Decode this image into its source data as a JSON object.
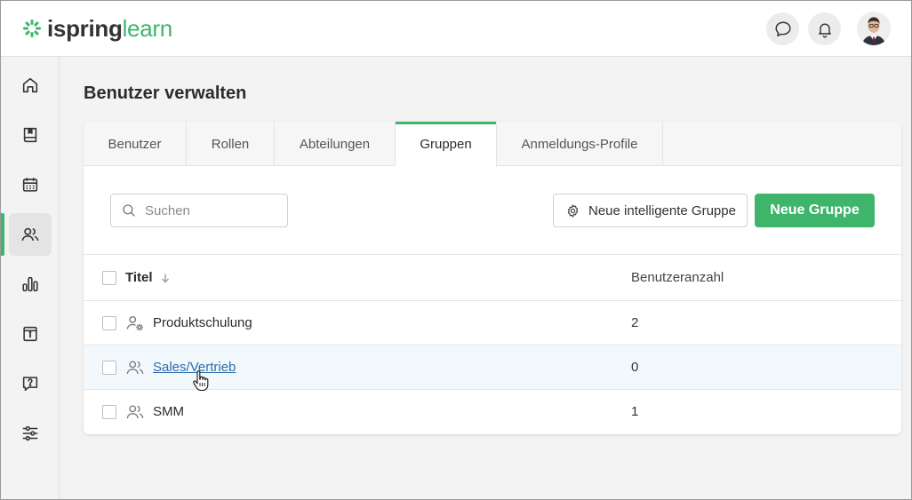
{
  "app": {
    "logo_part1": "ispring",
    "logo_part2": "learn",
    "brand_color": "#3fb56c"
  },
  "header": {
    "icons": [
      "chat-icon",
      "bell-icon"
    ]
  },
  "sidebar": {
    "items": [
      {
        "name": "home-icon"
      },
      {
        "name": "book-icon"
      },
      {
        "name": "calendar-icon"
      },
      {
        "name": "users-icon",
        "active": true
      },
      {
        "name": "reports-icon"
      },
      {
        "name": "info-icon"
      },
      {
        "name": "help-icon"
      },
      {
        "name": "settings-sliders-icon"
      }
    ]
  },
  "page": {
    "title": "Benutzer verwalten"
  },
  "tabs": [
    {
      "label": "Benutzer"
    },
    {
      "label": "Rollen"
    },
    {
      "label": "Abteilungen"
    },
    {
      "label": "Gruppen",
      "active": true
    },
    {
      "label": "Anmeldungs-Profile"
    }
  ],
  "toolbar": {
    "search_placeholder": "Suchen",
    "search_value": "",
    "smart_group_label": "Neue intelligente Gruppe",
    "new_group_label": "Neue Gruppe"
  },
  "table": {
    "headers": {
      "title": "Titel",
      "count": "Benutzeranzahl"
    },
    "rows": [
      {
        "title": "Produktschulung",
        "count": "2",
        "icon": "smart-group-icon"
      },
      {
        "title": "Sales/Vertrieb",
        "count": "0",
        "icon": "group-icon",
        "hovered": true
      },
      {
        "title": "SMM",
        "count": "1",
        "icon": "group-icon"
      }
    ]
  }
}
